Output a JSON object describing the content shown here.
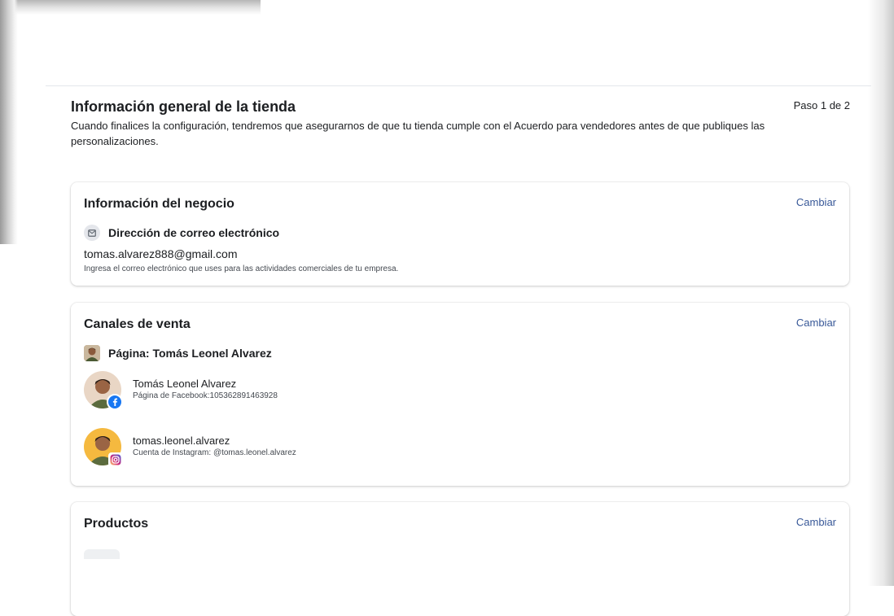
{
  "header": {
    "title": "Información general de la tienda",
    "description": "Cuando finalices la configuración, tendremos que asegurarnos de que tu tienda cumple con el Acuerdo para vendedores antes de que publiques las personalizaciones.",
    "step": "Paso 1 de 2"
  },
  "business": {
    "title": "Información del negocio",
    "change": "Cambiar",
    "email_label": "Dirección de correo electrónico",
    "email_icon": "mail-icon",
    "email_value": "tomas.alvarez888@gmail.com",
    "email_hint": "Ingresa el correo electrónico que uses para las actividades comerciales de tu empresa."
  },
  "channels": {
    "title": "Canales de venta",
    "change": "Cambiar",
    "page_label": "Página: Tomás Leonel Alvarez",
    "accounts": [
      {
        "name": "Tomás Leonel Alvarez",
        "sub": "Página de Facebook:105362891463928",
        "badge": "facebook-icon"
      },
      {
        "name": "tomas.leonel.alvarez",
        "sub": "Cuenta de Instagram: @tomas.leonel.alvarez",
        "badge": "instagram-icon"
      }
    ]
  },
  "products": {
    "title": "Productos",
    "change": "Cambiar"
  },
  "colors": {
    "link": "#385898",
    "facebook": "#1877f2",
    "instagram": "#d6249f",
    "avatar_bg_facebook": "#e9d6c5",
    "avatar_bg_instagram": "#f5b93f"
  }
}
